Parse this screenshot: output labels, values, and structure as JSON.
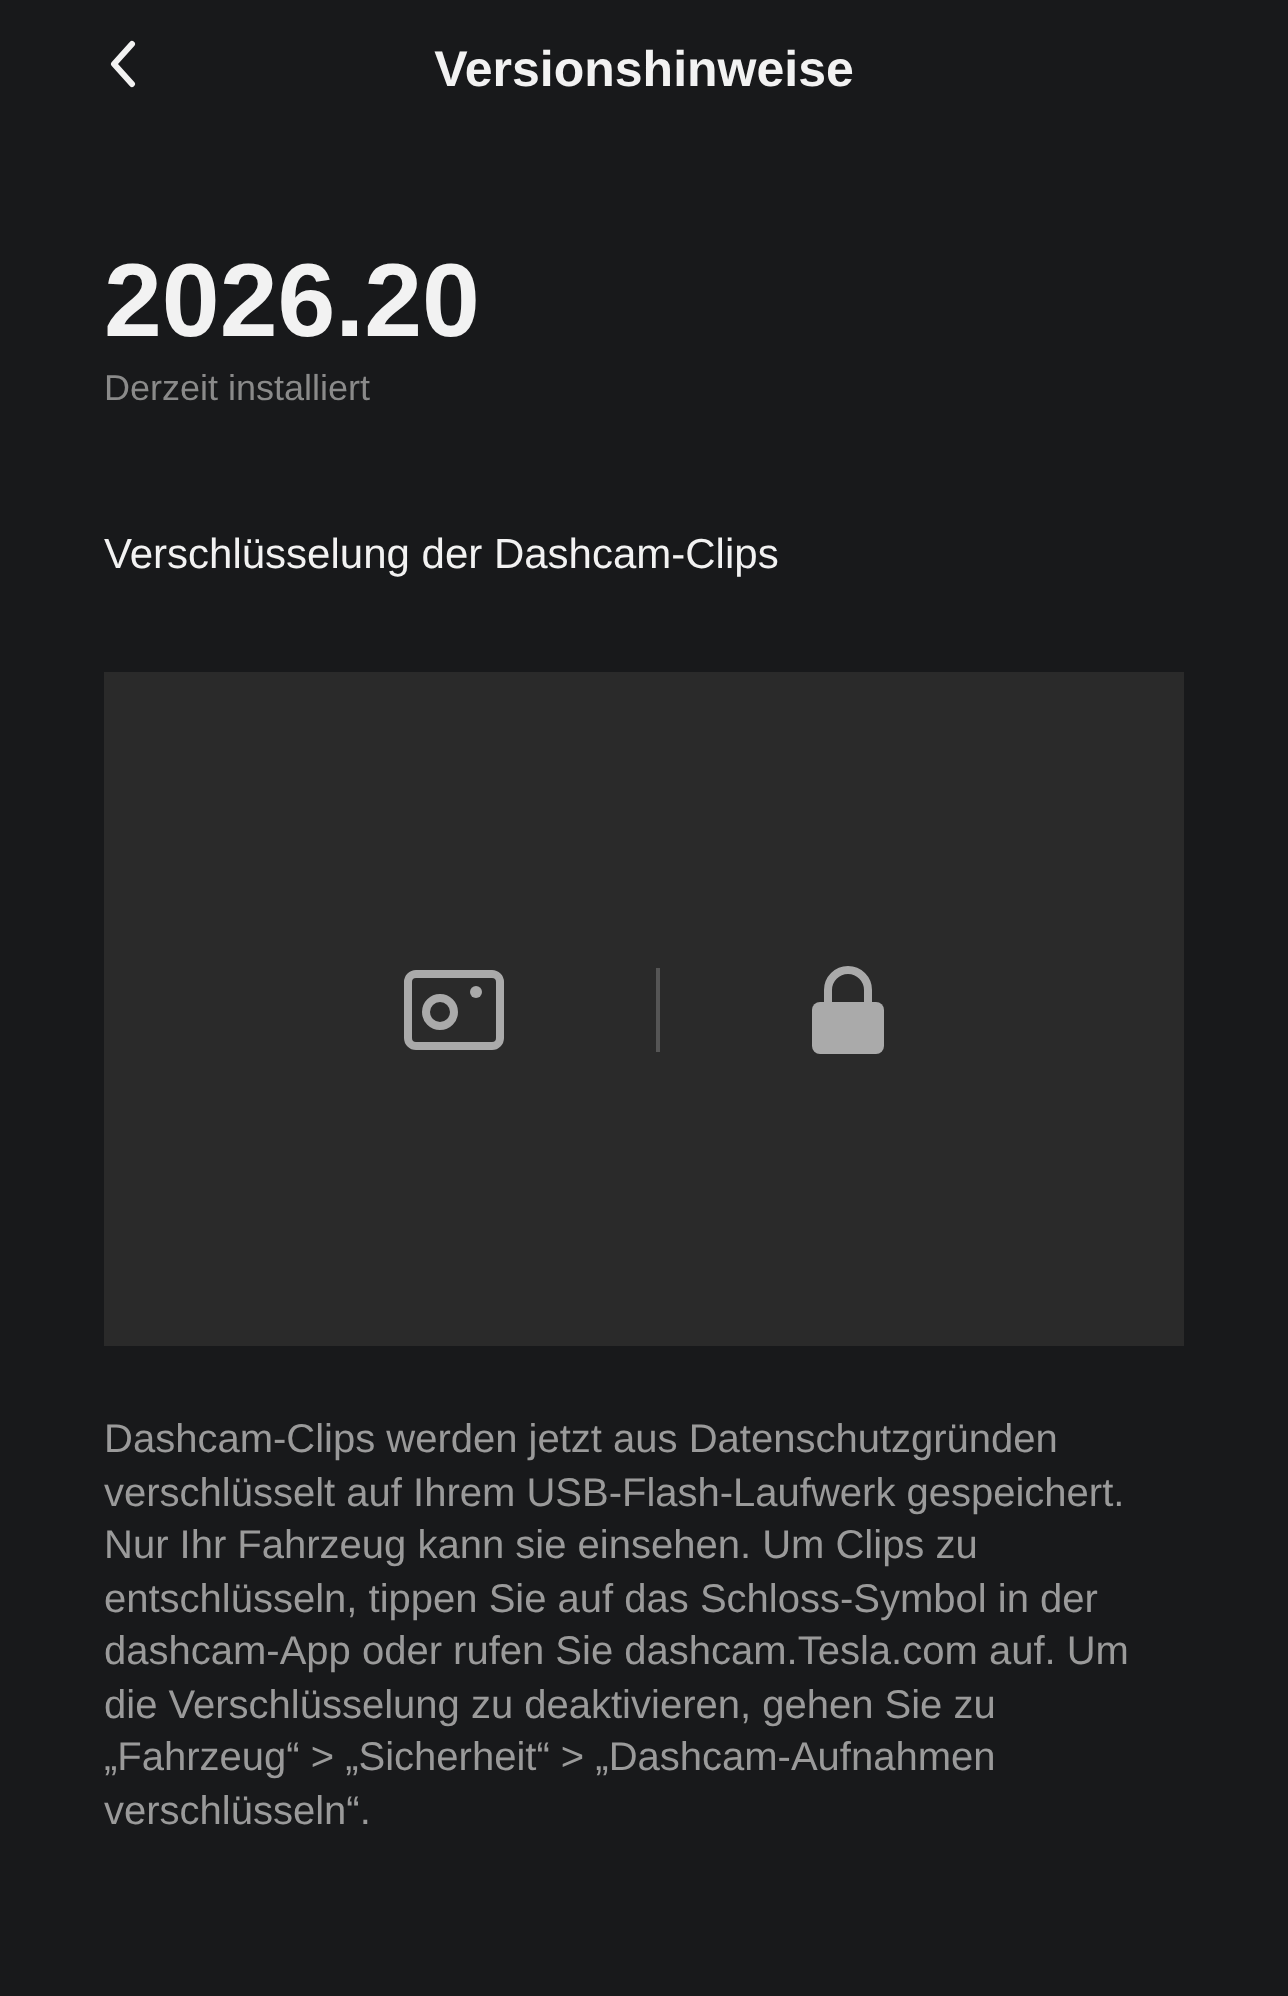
{
  "header": {
    "title": "Versionshinweise"
  },
  "version": {
    "number": "2026.20",
    "status": "Derzeit installiert"
  },
  "section": {
    "title": "Verschlüsselung der Dashcam-Clips"
  },
  "description": "Dashcam-Clips werden jetzt aus Datenschutzgründen verschlüsselt auf Ihrem USB-Flash-Laufwerk gespeichert. Nur Ihr Fahrzeug kann sie einsehen.  Um Clips zu entschlüsseln, tippen Sie auf das Schloss-Symbol in der dashcam-App oder rufen Sie dashcam.Tesla.com auf.  Um die Verschlüsselung zu deaktivieren, gehen Sie zu „Fahrzeug“ > „Sicherheit“ > „Dashcam-Aufnahmen verschlüsseln“."
}
